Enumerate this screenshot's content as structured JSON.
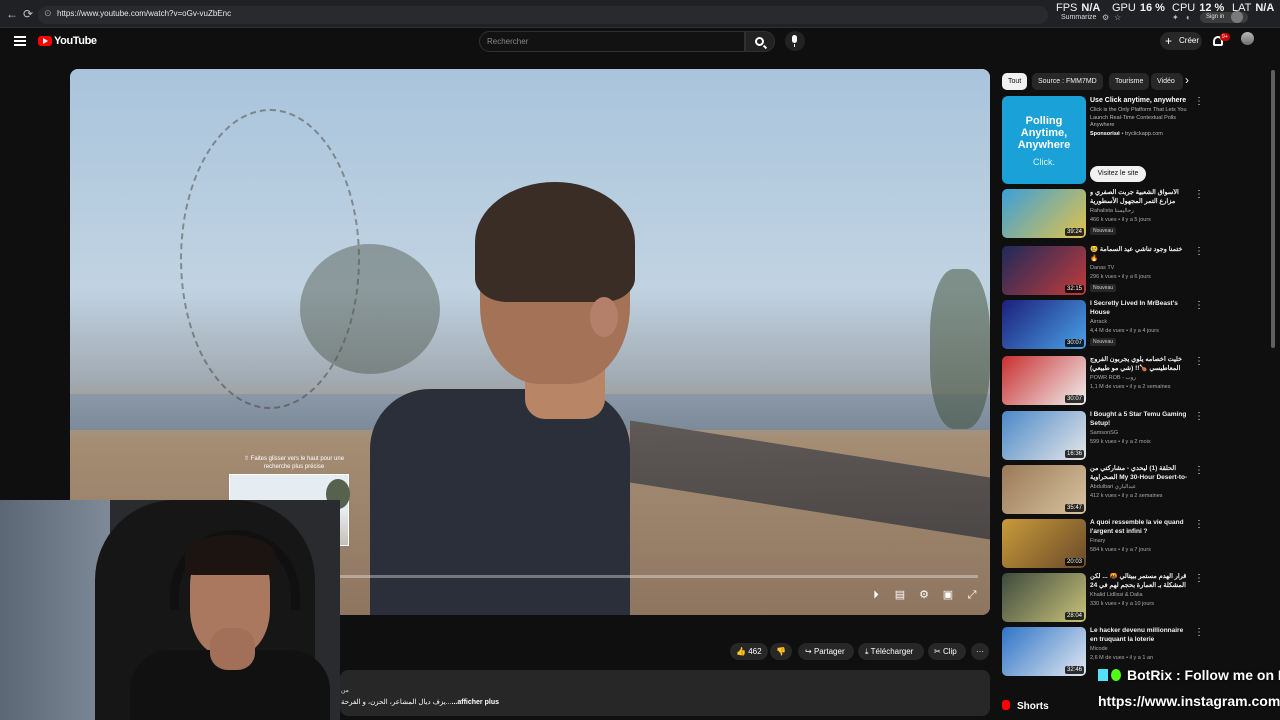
{
  "browser": {
    "url": "https://www.youtube.com/watch?v=oGv-vuZbEnc",
    "back": "←",
    "forward": "→",
    "reload": "⟳"
  },
  "overlay_stats": {
    "fps_label": "FPS",
    "fps_value": "N/A",
    "gpu_label": "GPU",
    "gpu_value": "16 %",
    "cpu_label": "CPU",
    "cpu_value": "12 %",
    "lat_label": "LAT",
    "lat_value": "N/A",
    "summarize": "Summarize",
    "sign_in": "Sign in"
  },
  "header": {
    "logo_text": "YouTube",
    "search_placeholder": "Rechercher",
    "create_label": "Créer",
    "notifications_badge": "9+"
  },
  "player": {
    "seek_hint": "⇧ Faites glisser vers le haut pour une recherche plus précise",
    "progress_fraction": 0.0
  },
  "actions": {
    "likes": "462",
    "share": "Partager",
    "download": "Télécharger",
    "clip": "Clip",
    "more": "···"
  },
  "description": {
    "arabic_snippet": "من",
    "text": "يزف ديال المشاعر، الحزن، و الفرحة...",
    "show_more": "...afficher plus"
  },
  "sidebar": {
    "chips": [
      "Tout",
      "Source : FMM7MD",
      "Tourisme",
      "Vidéo"
    ],
    "ad": {
      "headline": "Use Click anytime, anywhere",
      "body": "Click is the Only Platform That Lets You Launch Real-Time Contextual Polls Anywhere",
      "sponsored": "Sponsorisé",
      "domain": "tryclickapp.com",
      "visit": "Visitez le site",
      "image_text": "Polling Anytime, Anywhere",
      "image_sub": "Click."
    },
    "videos": [
      {
        "title": "الأسواق الشعبية جربت الصفري و مزارع التمر المجهول الأسطورية",
        "channel": "Rahalista رحاليستا",
        "meta": "466 k vues • il y a 5 jours",
        "badge": "Nouveau",
        "duration": "39:24"
      },
      {
        "title": "😢 ختمنا وجود تناشي عيد السمامة 🔥",
        "channel": "Danas TV",
        "meta": "296 k vues • il y a 6 jours",
        "badge": "Nouveau",
        "duration": "32:15"
      },
      {
        "title": "I Secretly Lived In MrBeast's House",
        "channel": "Airrack",
        "meta": "4,4 M de vues • il y a 4 jours",
        "badge": "Nouveau",
        "duration": "30:07"
      },
      {
        "title": "خليت أخصامه يلوي يجربون الفروج المعاطيسي 🍗!! (شي مو طبيعي)",
        "channel": "POWR ROB - روب",
        "meta": "1,1 M de vues • il y a 2 semaines",
        "badge": "",
        "duration": "30:07"
      },
      {
        "title": "I Bought a 5 Star Temu Gaming Setup!",
        "channel": "SamsonSG",
        "meta": "599 k vues • il y a 2 mois",
        "badge": "",
        "duration": "16:36"
      },
      {
        "title": "الحلقة (1) ليحدي - مشاركتي من الصحراوية My 30-Hour Desert-to- ... المغرب",
        "channel": "Abdulbari عبدالباري",
        "meta": "412 k vues • il y a 2 semaines",
        "badge": "",
        "duration": "35:47"
      },
      {
        "title": "À quoi ressemble la vie quand l'argent est infini ?",
        "channel": "Finary",
        "meta": "584 k vues • il y a 7 jours",
        "badge": "",
        "duration": "20:03"
      },
      {
        "title": "قرار الهدم مستمر ببيتالي 🤬 ... لكن المشكلة بـ العمارة بحجم لهم في 24 مليون الحمد لله",
        "channel": "Khalid Lidlissi & Dalia",
        "meta": "330 k vues • il y a 10 jours",
        "badge": "",
        "duration": "28:04"
      },
      {
        "title": "Le hacker devenu millionnaire en truquant la loterie",
        "channel": "Micode",
        "meta": "2,6 M de vues • il y a 1 an",
        "badge": "",
        "duration": "32:46"
      }
    ],
    "shorts_label": "Shorts"
  },
  "stream_overlay": {
    "botrix": "BotRix : Follow me on Instag",
    "instagram_url": "https://www.instagram.com/amso"
  },
  "colors": {
    "accent": "#ff0000",
    "bg": "#0f0f0f",
    "ad_blue": "#1aa2d8"
  }
}
